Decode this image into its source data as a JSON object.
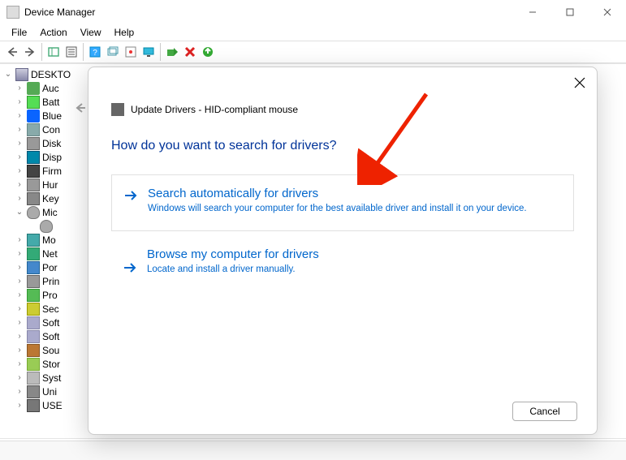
{
  "window": {
    "title": "Device Manager"
  },
  "menu": {
    "file": "File",
    "action": "Action",
    "view": "View",
    "help": "Help"
  },
  "tree": {
    "root": "DESKTO",
    "items": [
      {
        "label": "Auc",
        "icon": "ic-aud"
      },
      {
        "label": "Batt",
        "icon": "ic-bat"
      },
      {
        "label": "Blue",
        "icon": "ic-bt"
      },
      {
        "label": "Con",
        "icon": "ic-com"
      },
      {
        "label": "Disk",
        "icon": "ic-disk"
      },
      {
        "label": "Disp",
        "icon": "ic-disp"
      },
      {
        "label": "Firm",
        "icon": "ic-firm"
      },
      {
        "label": "Hur",
        "icon": "ic-hid"
      },
      {
        "label": "Key",
        "icon": "ic-kb"
      },
      {
        "label": "Mic",
        "icon": "ic-mouse",
        "expanded": true,
        "children": [
          {
            "label": "",
            "icon": "ic-mouse"
          }
        ]
      },
      {
        "label": "Mo",
        "icon": "ic-mo"
      },
      {
        "label": "Net",
        "icon": "ic-net"
      },
      {
        "label": "Por",
        "icon": "ic-port"
      },
      {
        "label": "Prin",
        "icon": "ic-print"
      },
      {
        "label": "Pro",
        "icon": "ic-proc"
      },
      {
        "label": "Sec",
        "icon": "ic-sec"
      },
      {
        "label": "Soft",
        "icon": "ic-soft"
      },
      {
        "label": "Soft",
        "icon": "ic-soft"
      },
      {
        "label": "Sou",
        "icon": "ic-sound"
      },
      {
        "label": "Stor",
        "icon": "ic-stor"
      },
      {
        "label": "Syst",
        "icon": "ic-sys"
      },
      {
        "label": "Uni",
        "icon": "ic-uni"
      },
      {
        "label": "USE",
        "icon": "ic-usb"
      }
    ]
  },
  "dialog": {
    "title": "Update Drivers - HID-compliant mouse",
    "question": "How do you want to search for drivers?",
    "option1": {
      "title": "Search automatically for drivers",
      "desc": "Windows will search your computer for the best available driver and install it on your device."
    },
    "option2": {
      "title": "Browse my computer for drivers",
      "desc": "Locate and install a driver manually."
    },
    "cancel": "Cancel"
  }
}
